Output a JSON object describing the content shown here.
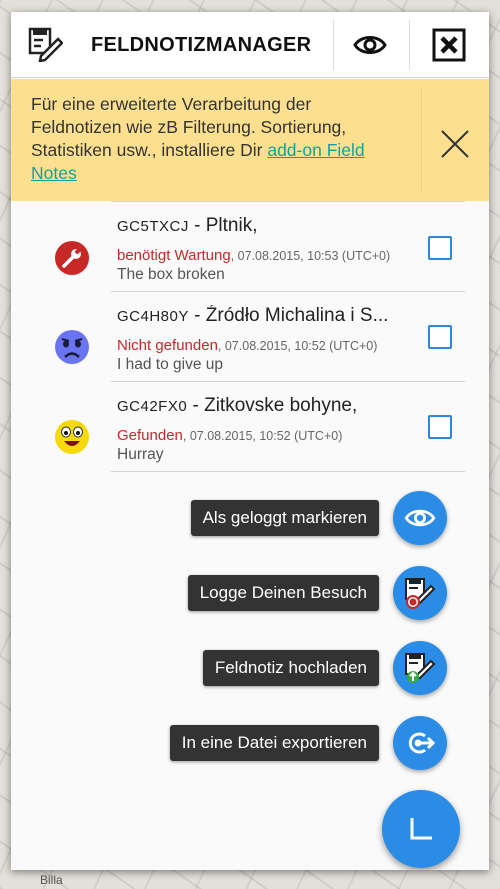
{
  "header": {
    "title": "FELDNOTIZMANAGER",
    "app_icon": "feldnotiz-app-icon",
    "eye_icon": "eye-icon",
    "close_icon": "close-box-icon"
  },
  "banner": {
    "text": "Für eine erweiterte Verarbeitung der Feldnotizen wie zB Filterung. Sortierung, Statistiken usw., installiere Dir ",
    "link": "add-on Field Notes",
    "close_icon": "close-icon",
    "background": "#fde08f",
    "link_color": "#11a39a"
  },
  "items": [
    {
      "code": "GC5TXCJ",
      "name": "Pltnik,",
      "status": "benötigt Wartung",
      "datetime": "07.08.2015, 10:53 (UTC+0)",
      "comment": "The box broken",
      "icon": "wrench-icon",
      "checked": false
    },
    {
      "code": "GC4H80Y",
      "name": "Źródło Michalina i S...",
      "status": "Nicht gefunden",
      "datetime": "07.08.2015, 10:52 (UTC+0)",
      "comment": "I had to give up",
      "icon": "sad-face-icon",
      "checked": false
    },
    {
      "code": "GC42FX0",
      "name": "Zitkovske bohyne,",
      "status": "Gefunden",
      "datetime": "07.08.2015, 10:52 (UTC+0)",
      "comment": "Hurray",
      "icon": "happy-face-icon",
      "checked": false
    }
  ],
  "actions": {
    "mark_logged": "Als geloggt markieren",
    "log_visit": "Logge Deinen Besuch",
    "upload_note": "Feldnotiz hochladen",
    "export_file": "In eine Datei exportieren"
  },
  "map": {
    "label": "Billa"
  },
  "colors": {
    "accent": "#2b8ce6",
    "status_red": "#c62828"
  }
}
